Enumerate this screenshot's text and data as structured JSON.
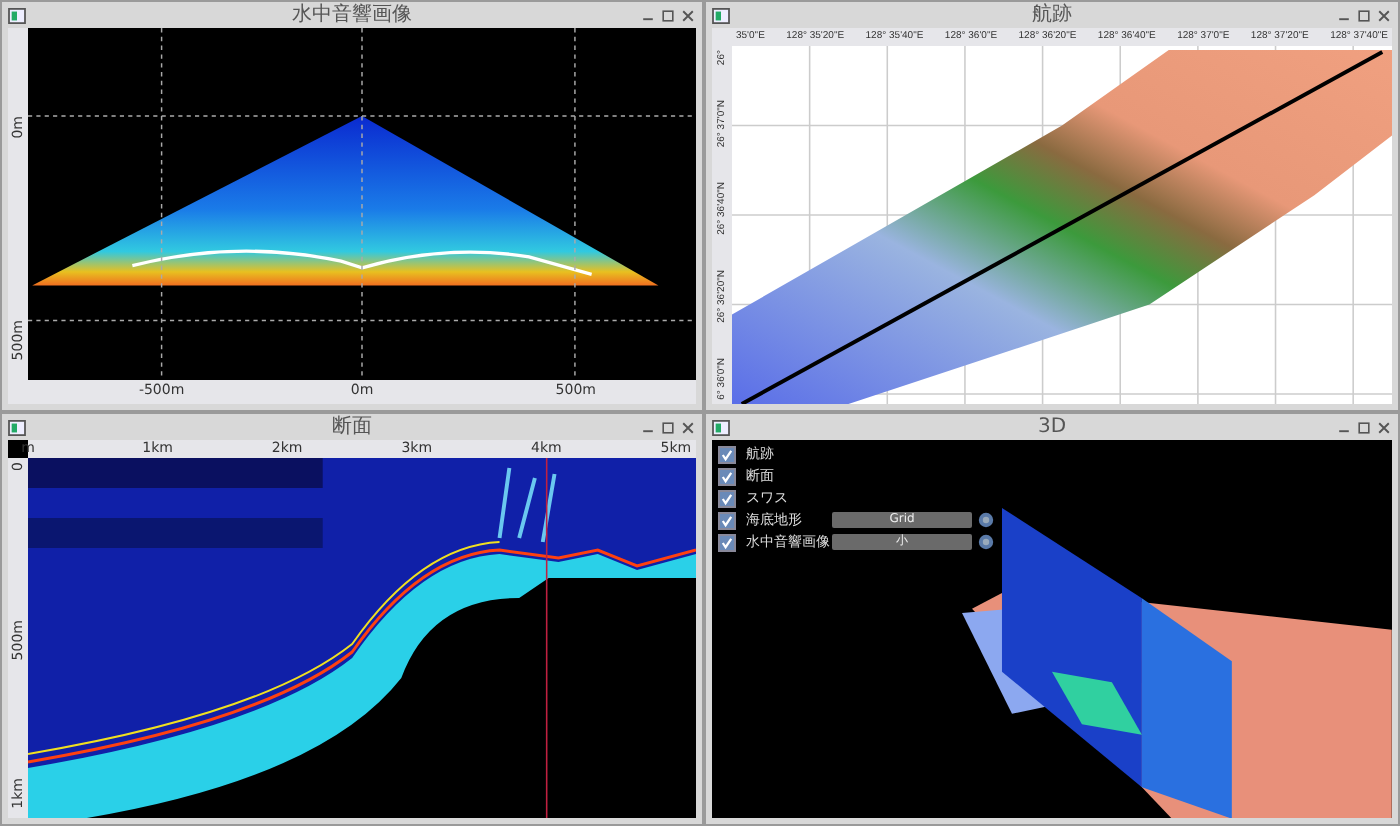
{
  "panels": [
    {
      "kind": "sonar",
      "title": "水中音響画像",
      "y_labels": [
        "0m",
        "500m"
      ],
      "x_labels": [
        "-500m",
        "0m",
        "500m"
      ]
    },
    {
      "kind": "map",
      "title": "航跡",
      "x_labels": [
        "35'0\"E",
        "128° 35'20\"E",
        "128° 35'40\"E",
        "128° 36'0\"E",
        "128° 36'20\"E",
        "128° 36'40\"E",
        "128° 37'0\"E",
        "128° 37'20\"E",
        "128° 37'40\"E"
      ],
      "y_labels": [
        "26°",
        "26° 37'0\"N",
        "26° 36'40\"N",
        "26° 36'20\"N",
        "6° 36'0\"N"
      ]
    },
    {
      "kind": "echogram",
      "title": "断面",
      "x_labels": [
        "m",
        "1km",
        "2km",
        "3km",
        "4km",
        "5km"
      ],
      "y_labels": [
        "0",
        "500m",
        "1km"
      ]
    },
    {
      "kind": "scene3d",
      "title": "3D",
      "layers": [
        {
          "label": "航跡",
          "checked": true
        },
        {
          "label": "断面",
          "checked": true
        },
        {
          "label": "スワス",
          "checked": true
        },
        {
          "label": "海底地形",
          "checked": true,
          "option": "Grid"
        },
        {
          "label": "水中音響画像",
          "checked": true,
          "option": "小"
        }
      ]
    }
  ]
}
